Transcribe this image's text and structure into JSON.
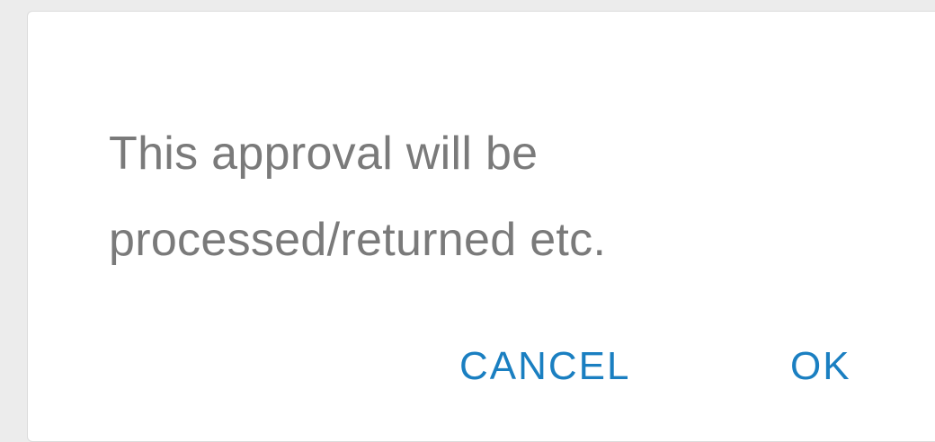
{
  "dialog": {
    "message_line1": "This approval will be",
    "message_line2": "processed/returned etc.",
    "cancel_label": "CANCEL",
    "ok_label": "OK"
  },
  "colors": {
    "accent": "#1a7fc1",
    "message_text": "#7a7a7a",
    "backdrop": "#ececec",
    "dialog_background": "#ffffff"
  }
}
